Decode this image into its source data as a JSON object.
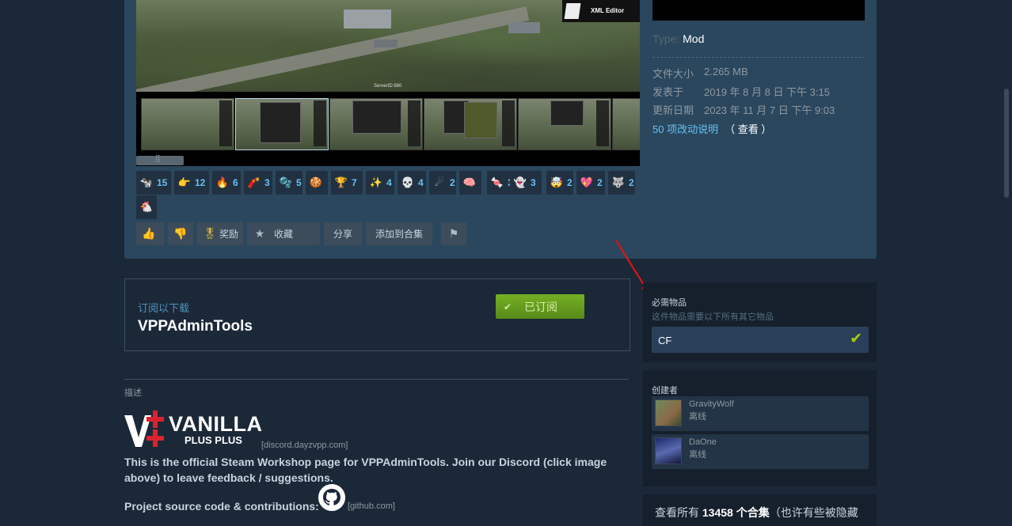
{
  "media": {
    "xml_editor_label": "XML Editor",
    "server_id_label": "ServerID:980"
  },
  "awards": [
    {
      "icon": "cow-icon",
      "glyph": "🐄",
      "count": "15"
    },
    {
      "icon": "hand-icon",
      "glyph": "👉",
      "count": "12"
    },
    {
      "icon": "fire-boot-icon",
      "glyph": "🔥",
      "count": "6"
    },
    {
      "icon": "rocket-icon",
      "glyph": "🧨",
      "count": "3"
    },
    {
      "icon": "bubbles-icon",
      "glyph": "🫧",
      "count": "5"
    },
    {
      "icon": "cookie-icon",
      "glyph": "🍪",
      "count": ""
    },
    {
      "icon": "podium-icon",
      "glyph": "🏆",
      "count": "7"
    },
    {
      "icon": "sparkle-icon",
      "glyph": "✨",
      "count": "4"
    },
    {
      "icon": "skull-helmet-icon",
      "glyph": "💀",
      "count": "4"
    },
    {
      "icon": "comet-icon",
      "glyph": "☄",
      "count": "2"
    },
    {
      "icon": "brain-icon",
      "glyph": "🧠",
      "count": ""
    },
    {
      "icon": "candy-icon",
      "glyph": "🍬",
      "count": "3"
    },
    {
      "icon": "ghost-icon",
      "glyph": "👻",
      "count": "3"
    },
    {
      "icon": "mind-blown-icon",
      "glyph": "🤯",
      "count": "2"
    },
    {
      "icon": "heart-icon",
      "glyph": "💖",
      "count": "2"
    },
    {
      "icon": "wolf-icon",
      "glyph": "🐺",
      "count": "2"
    },
    {
      "icon": "chicken-icon",
      "glyph": "🐔",
      "count": ""
    }
  ],
  "actions": {
    "thumbs_up_icon": "thumbs-up-icon",
    "thumbs_down_icon": "thumbs-down-icon",
    "award_label": "奖励",
    "favorite_label": "收藏",
    "share_label": "分享",
    "add_to_collection_label": "添加到合集",
    "flag_icon": "flag-icon"
  },
  "info": {
    "type_label": "Type:",
    "type_value": "Mod",
    "file_size_label": "文件大小",
    "file_size_value": "2.265 MB",
    "posted_label": "发表于",
    "posted_value": "2019 年 8 月 8 日 下午 3:15",
    "updated_label": "更新日期",
    "updated_value": "2023 年 11 月 7 日 下午 9:03",
    "change_notes_link": "50 项改动说明",
    "view_label": "（ 查看 ）"
  },
  "subscribe": {
    "label": "订阅以下载",
    "title": "VPPAdminTools",
    "button_label": "已订阅"
  },
  "required": {
    "title": "必需物品",
    "subtitle": "这件物品需要以下所有其它物品",
    "items": [
      {
        "name": "CF"
      }
    ]
  },
  "creators": {
    "title": "创建者",
    "list": [
      {
        "name": "GravityWolf",
        "status": "离线"
      },
      {
        "name": "DaOne",
        "status": "离线"
      }
    ]
  },
  "collections": {
    "prefix": "查看所有 ",
    "count": "13458",
    "suffix": " 个合集",
    "note": "（也许有些被隐藏"
  },
  "description": {
    "label": "描述",
    "logo_line1": "VANILLA",
    "logo_line2": "PLUS PLUS",
    "discord_link": "[discord.dayzvpp.com]",
    "paragraph": "This is the official Steam Workshop page for VPPAdminTools. Join our Discord (click image above) to leave feedback / suggestions.",
    "source_label": "Project source code & contributions:",
    "github_link": "[github.com]"
  },
  "colors": {
    "accent_blue": "#66c0f4",
    "subscribed_green": "#75b022",
    "page_bg": "#1b2838"
  }
}
